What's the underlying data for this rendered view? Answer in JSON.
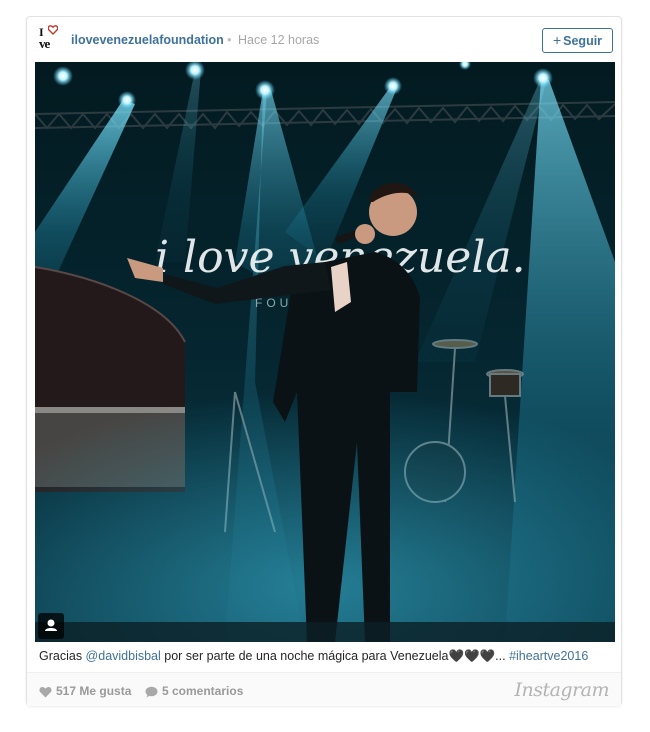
{
  "header": {
    "logo_text_top": "I",
    "logo_text_bottom": "ve",
    "username": "ilovevenezuelafoundation",
    "separator": "•",
    "timestamp": "Hace 12 horas",
    "follow_plus": "+",
    "follow_label": "Seguir"
  },
  "photo": {
    "backdrop_text": "i love venezuela.",
    "stage_sign": "FOU"
  },
  "caption": {
    "lead": "Gracias ",
    "mention": "@davidbisbal",
    "body": " por ser parte de una noche mágica para Venezuela🖤🖤🖤... ",
    "hashtag": "#iheartve2016"
  },
  "footer": {
    "likes": "517 Me gusta",
    "comments": "5 comentarios",
    "brand": "Instagram"
  },
  "colors": {
    "link": "#3f729b",
    "muted": "#a5a7aa",
    "stage_light": "#3fd0ff"
  }
}
